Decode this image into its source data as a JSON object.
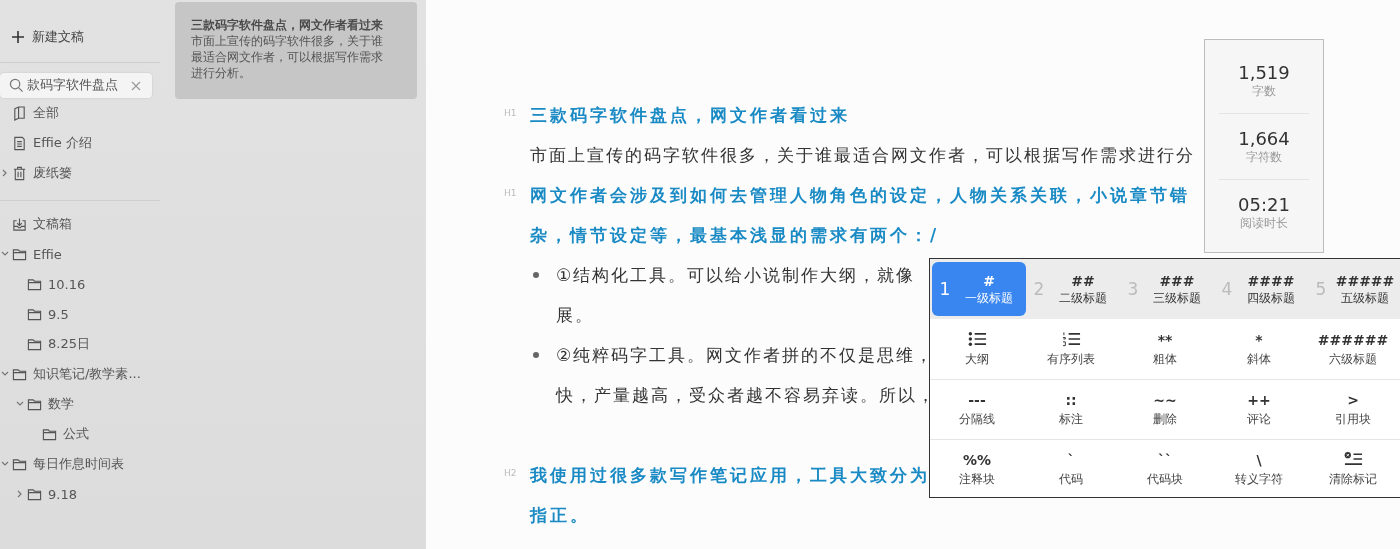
{
  "sidebar": {
    "new_button": "新建文稿",
    "search": {
      "value": "款码字软件盘点"
    },
    "library": [
      {
        "label": "全部",
        "kind": "book"
      },
      {
        "label": "Effie 介绍",
        "kind": "doc"
      },
      {
        "label": "废纸篓",
        "kind": "trash",
        "expanded": false
      }
    ],
    "tree": [
      {
        "label": "文稿箱",
        "kind": "inbox"
      },
      {
        "label": "Effie",
        "kind": "folder",
        "expanded": true,
        "children": [
          {
            "label": "10.16",
            "kind": "folder"
          },
          {
            "label": "9.5",
            "kind": "folder"
          },
          {
            "label": "8.25日",
            "kind": "folder"
          }
        ]
      },
      {
        "label": "知识笔记/教学素...",
        "kind": "folder",
        "expanded": true,
        "children": [
          {
            "label": "数学",
            "kind": "folder",
            "expanded": true,
            "children": [
              {
                "label": "公式",
                "kind": "folder"
              }
            ]
          }
        ]
      },
      {
        "label": "每日作息时间表",
        "kind": "folder",
        "expanded": true,
        "children": [
          {
            "label": "9.18",
            "kind": "folder",
            "expanded": false
          }
        ]
      }
    ]
  },
  "doc_list": [
    {
      "title": "三款码字软件盘点，网文作者看过来",
      "summary": "市面上宣传的码字软件很多，关于谁最适合网文作者，可以根据写作需求进行分析。",
      "selected": true
    }
  ],
  "editor": {
    "blocks": [
      {
        "kind": "heading",
        "marker": "H1",
        "lines": [
          "三款码字软件盘点，网文作者看过来"
        ]
      },
      {
        "kind": "paragraph",
        "lines": [
          "市面上宣传的码字软件很多，关于谁最适合网文作者，可以根据写作需求进行分"
        ]
      },
      {
        "kind": "heading",
        "marker": "H1",
        "lines": [
          "网文作者会涉及到如何去管理人物角色的设定，人物关系关联，小说章节错",
          "杂，情节设定等，最基本浅显的需求有两个：/"
        ]
      },
      {
        "kind": "bullet",
        "lines": [
          "①结构化工具。可以给小说制作大纲，就像",
          "展。"
        ]
      },
      {
        "kind": "bullet",
        "lines": [
          "②纯粹码字工具。网文作者拼的不仅是思维，",
          "快，产量越高，受众者越不容易弃读。所以，"
        ]
      },
      {
        "kind": "blank"
      },
      {
        "kind": "heading",
        "marker": "H2",
        "lines": [
          "我使用过很多款写作笔记应用，工具大致分为",
          "指正。"
        ]
      }
    ]
  },
  "stats": [
    {
      "value": "1,519",
      "label": "字数"
    },
    {
      "value": "1,664",
      "label": "字符数"
    },
    {
      "value": "05:21",
      "label": "阅读时长"
    }
  ],
  "format_menu": {
    "headings": [
      {
        "number": "1",
        "symbol": "#",
        "label": "一级标题",
        "selected": true
      },
      {
        "number": "2",
        "symbol": "##",
        "label": "二级标题",
        "selected": false
      },
      {
        "number": "3",
        "symbol": "###",
        "label": "三级标题",
        "selected": false
      },
      {
        "number": "4",
        "symbol": "####",
        "label": "四级标题",
        "selected": false
      },
      {
        "number": "5",
        "symbol": "#####",
        "label": "五级标题",
        "selected": false
      }
    ],
    "rows": [
      [
        {
          "kind": "bullet-list",
          "label": "大纲"
        },
        {
          "kind": "ordered-list",
          "label": "有序列表"
        },
        {
          "kind": "text",
          "symbol": "**",
          "label": "粗体"
        },
        {
          "kind": "text",
          "symbol": "*",
          "label": "斜体"
        },
        {
          "kind": "text",
          "symbol": "######",
          "label": "六级标题"
        }
      ],
      [
        {
          "kind": "text",
          "symbol": "---",
          "label": "分隔线"
        },
        {
          "kind": "text",
          "symbol": "::",
          "label": "标注"
        },
        {
          "kind": "text",
          "symbol": "~~",
          "label": "删除"
        },
        {
          "kind": "text",
          "symbol": "++",
          "label": "评论"
        },
        {
          "kind": "text",
          "symbol": ">",
          "label": "引用块"
        }
      ],
      [
        {
          "kind": "text",
          "symbol": "%%",
          "label": "注释块"
        },
        {
          "kind": "text",
          "symbol": "`",
          "label": "代码"
        },
        {
          "kind": "text",
          "symbol": "``",
          "label": "代码块"
        },
        {
          "kind": "text",
          "symbol": "\\",
          "label": "转义字符"
        },
        {
          "kind": "clear-format",
          "label": "清除标记"
        }
      ]
    ]
  }
}
